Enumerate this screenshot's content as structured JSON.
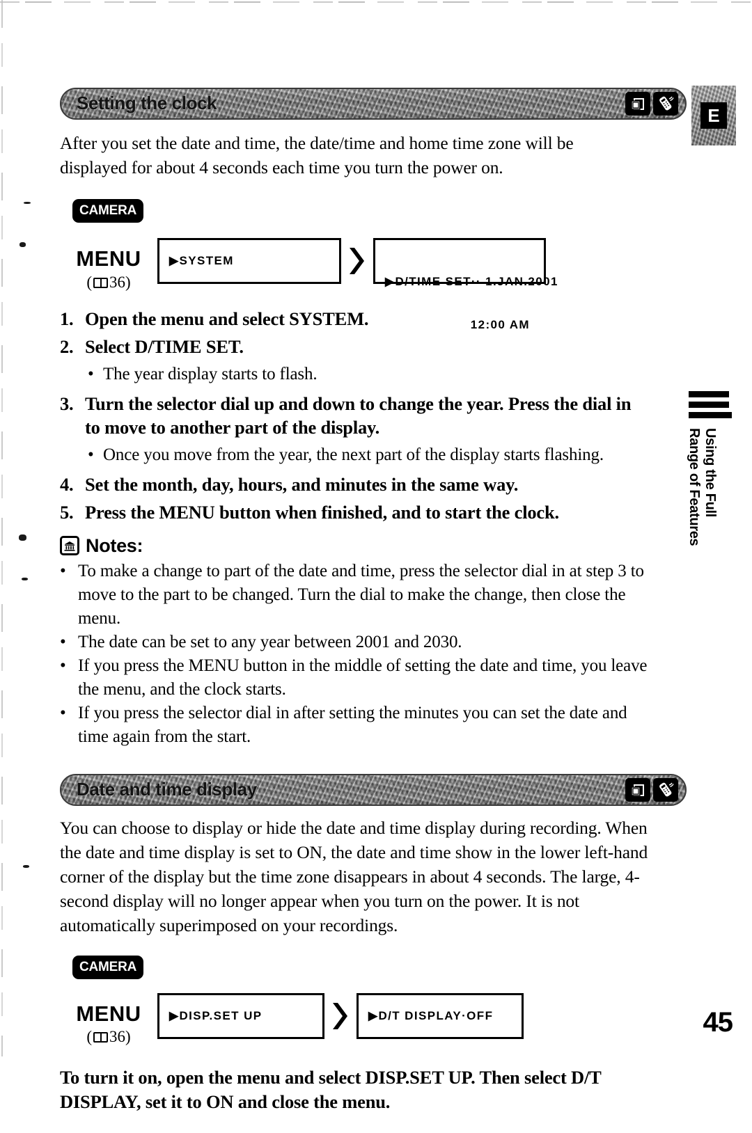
{
  "page": {
    "number": "45",
    "side_tab_letter": "E",
    "running_head": "Using the Full\nRange of Features"
  },
  "section1": {
    "title": "Setting the clock",
    "intro": "After you set the date and time, the date/time and home time zone will be displayed for about 4 seconds each time you turn the power on.",
    "mode_badge": "CAMERA",
    "menu": {
      "label": "MENU",
      "ref_prefix": "(",
      "ref_page": "36)",
      "box1": "▶SYSTEM",
      "box2_line1": "▶D/TIME SET·· 1.JAN.2001",
      "box2_line2": "12:00 AM",
      "arrow": "»"
    },
    "steps": [
      {
        "num": "1.",
        "text": "Open the menu and select SYSTEM.",
        "sub": []
      },
      {
        "num": "2.",
        "text": "Select D/TIME SET.",
        "sub": [
          "The year display starts to flash."
        ]
      },
      {
        "num": "3.",
        "text": "Turn the selector dial up and down to change the year. Press the dial in to move to another part of the display.",
        "sub": [
          "Once you move from the year, the next part of the display starts flashing."
        ]
      },
      {
        "num": "4.",
        "text": "Set the month, day, hours, and minutes in the same way.",
        "sub": []
      },
      {
        "num": "5.",
        "text": "Press the MENU button when finished, and to start the clock.",
        "sub": []
      }
    ],
    "notes_title": "Notes:",
    "notes": [
      "To make a change to part of the date and time, press the selector dial in at step 3 to move to the part to be changed. Turn the dial to make the change, then close the menu.",
      "The date can be set to any year between 2001 and 2030.",
      "If you press the MENU button in the middle of setting the date and time, you leave the menu, and the clock starts.",
      "If you press the selector dial in after setting the minutes you can set the date and time again from the start."
    ]
  },
  "section2": {
    "title": "Date and time display",
    "intro": "You can choose to display or hide the date and time display during recording. When the date and time display is set to ON, the date and time show in the lower left-hand corner of the display but the time zone disappears in about 4 seconds. The large, 4-second display will no longer appear when you turn on the power. It is not automatically superimposed on your recordings.",
    "mode_badge": "CAMERA",
    "menu": {
      "label": "MENU",
      "ref_prefix": "(",
      "ref_page": "36)",
      "box1": "▶DISP.SET UP",
      "box2": "▶D/T DISPLAY·OFF",
      "arrow": "»"
    },
    "closing": "To turn it on, open the menu and select DISP.SET UP. Then select D/T DISPLAY, set it to ON and close the menu."
  },
  "bullet_char": "•"
}
